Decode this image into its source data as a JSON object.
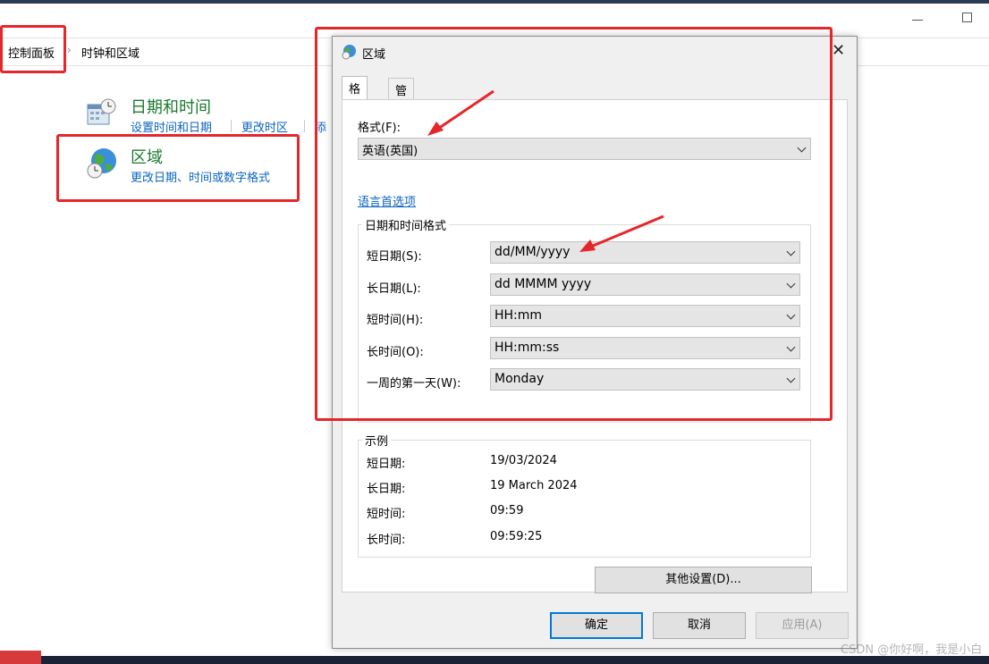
{
  "breadcrumb": {
    "root": "控制面板",
    "current": "时钟和区域"
  },
  "categories": {
    "datetime": {
      "title": "日期和时间",
      "links": [
        "设置时间和日期",
        "更改时区",
        "添"
      ]
    },
    "region": {
      "title": "区域",
      "link": "更改日期、时间或数字格式"
    }
  },
  "dialog": {
    "title": "区域",
    "tabs": [
      "格式",
      "管理"
    ],
    "format_label": "格式(F):",
    "format_value": "英语(英国)",
    "language_link": "语言首选项",
    "datetime_group": {
      "legend": "日期和时间格式",
      "rows": [
        {
          "label": "短日期(S):",
          "value": "dd/MM/yyyy"
        },
        {
          "label": "长日期(L):",
          "value": "dd MMMM yyyy"
        },
        {
          "label": "短时间(H):",
          "value": "HH:mm"
        },
        {
          "label": "长时间(O):",
          "value": "HH:mm:ss"
        },
        {
          "label": "一周的第一天(W):",
          "value": "Monday"
        }
      ]
    },
    "examples_group": {
      "legend": "示例",
      "rows": [
        {
          "label": "短日期:",
          "value": "19/03/2024"
        },
        {
          "label": "长日期:",
          "value": "19 March 2024"
        },
        {
          "label": "短时间:",
          "value": "09:59"
        },
        {
          "label": "长时间:",
          "value": "09:59:25"
        }
      ]
    },
    "other_settings": "其他设置(D)...",
    "ok": "确定",
    "cancel": "取消",
    "apply": "应用(A)"
  },
  "watermark": "CSDN @你好啊，我是小白",
  "colors": {
    "annotation_red": "#e5262b",
    "category_green": "#1b7a2e",
    "link_blue": "#0b64c0",
    "default_button_border": "#0078d7"
  }
}
